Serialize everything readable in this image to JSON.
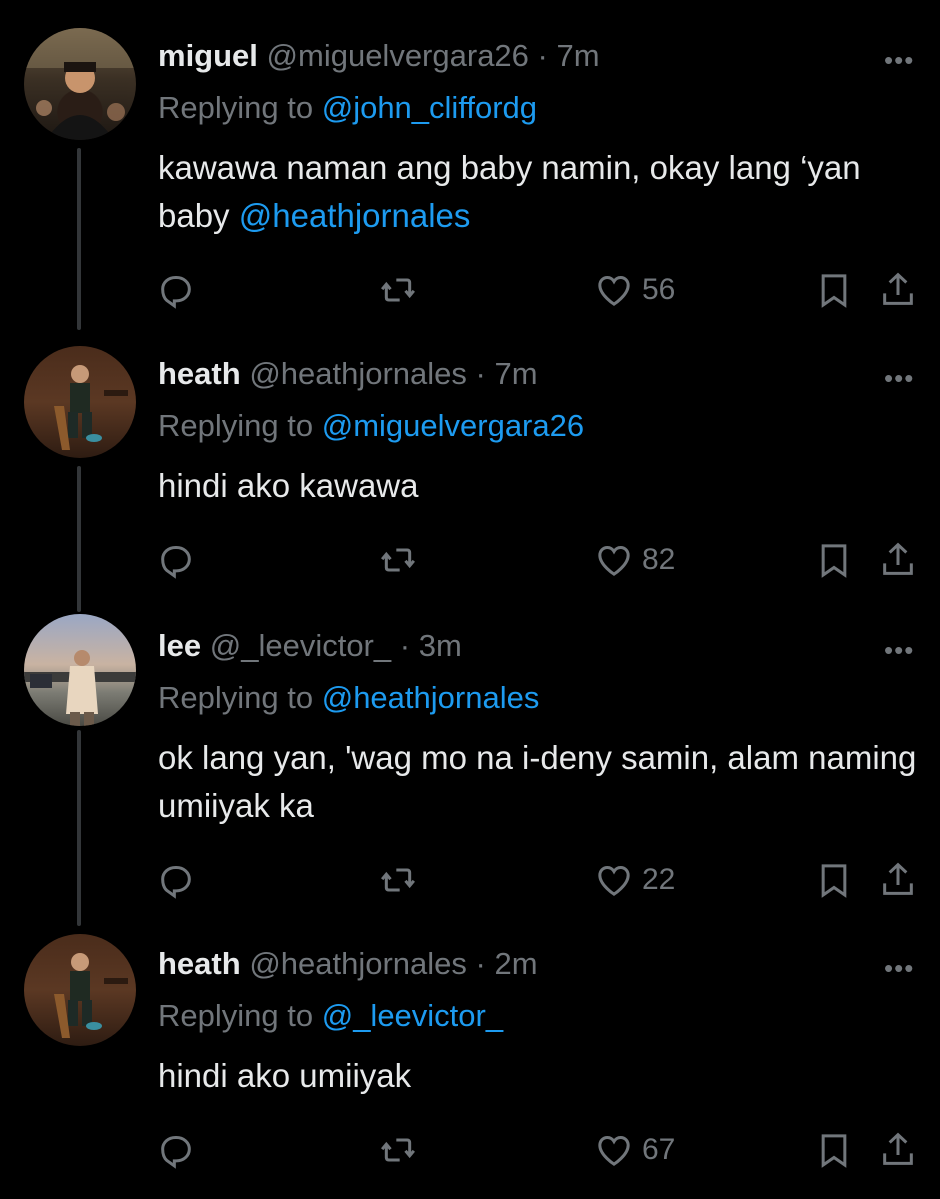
{
  "tweets": [
    {
      "name": "miguel",
      "handle": "@miguelvergara26",
      "sep": "·",
      "time": "7m",
      "replying_prefix": "Replying to",
      "replying_to": "@john_cliffordg",
      "text": "kawawa naman ang baby namin, okay lang ‘yan baby",
      "text_mention": "@heathjornales",
      "likes": "56"
    },
    {
      "name": "heath",
      "handle": "@heathjornales",
      "sep": "·",
      "time": "7m",
      "replying_prefix": "Replying to",
      "replying_to": "@miguelvergara26",
      "text": "hindi ako kawawa",
      "text_mention": "",
      "likes": "82"
    },
    {
      "name": "lee",
      "handle": "@_leevictor_",
      "sep": "·",
      "time": "3m",
      "replying_prefix": "Replying to",
      "replying_to": "@heathjornales",
      "text": "ok lang yan, 'wag mo na i-deny samin, alam naming umiiyak ka",
      "text_mention": "",
      "likes": "22"
    },
    {
      "name": "heath",
      "handle": "@heathjornales",
      "sep": "·",
      "time": "2m",
      "replying_prefix": "Replying to",
      "replying_to": "@_leevictor_",
      "text": "hindi ako umiiyak",
      "text_mention": "",
      "likes": "67"
    }
  ],
  "more_glyph": "•••",
  "colors": {
    "background": "#000000",
    "text": "#e7e9ea",
    "muted": "#71767b",
    "link": "#1d9bf0",
    "thread": "#333639"
  },
  "icons": [
    "reply-icon",
    "retweet-icon",
    "heart-icon",
    "bookmark-icon",
    "share-icon",
    "more-icon"
  ]
}
